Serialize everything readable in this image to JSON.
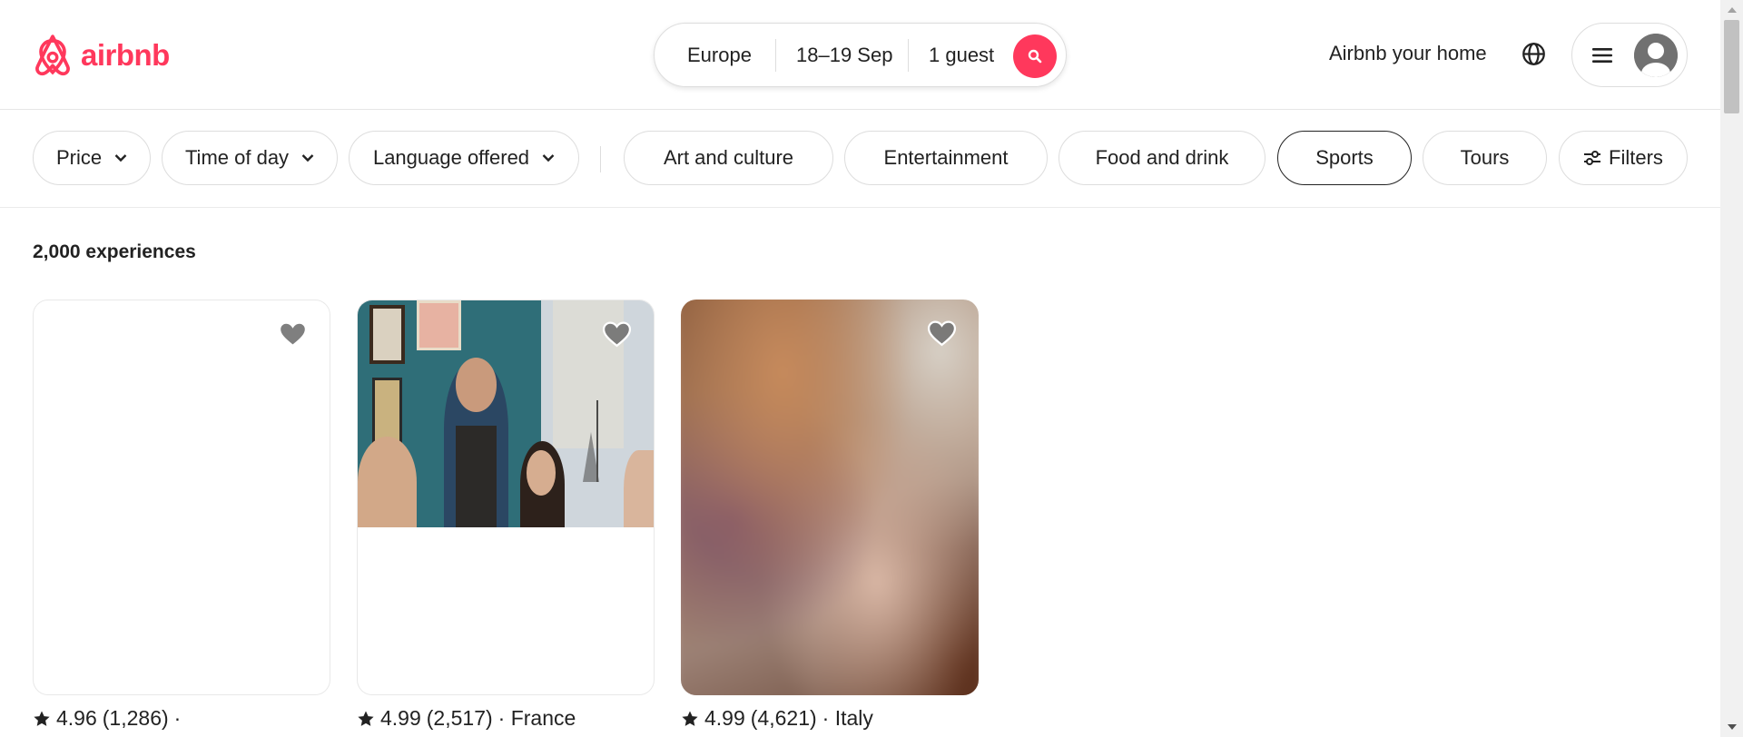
{
  "colors": {
    "brand": "#FF385C",
    "text": "#222222",
    "heart": "#717171"
  },
  "header": {
    "logo_text": "airbnb",
    "search": {
      "where": "Europe",
      "when": "18–19 Sep",
      "who": "1 guest",
      "icon": "search-icon"
    },
    "host_link": "Airbnb your home",
    "globe_icon": "globe-icon",
    "menu_icon": "hamburger-icon",
    "avatar_icon": "user-avatar-icon"
  },
  "filters": {
    "dropdowns": [
      {
        "label": "Price"
      },
      {
        "label": "Time of day"
      },
      {
        "label": "Language offered"
      }
    ],
    "categories": [
      {
        "label": "Art and culture",
        "selected": false
      },
      {
        "label": "Entertainment",
        "selected": false
      },
      {
        "label": "Food and drink",
        "selected": false
      },
      {
        "label": "Sports",
        "selected": true
      },
      {
        "label": "Tours",
        "selected": false
      }
    ],
    "filters_button": "Filters"
  },
  "results": {
    "count": "2,000 experiences",
    "cards": [
      {
        "rating": "4.96",
        "reviews": "(1,286)",
        "location": "·",
        "image": "blank"
      },
      {
        "rating": "4.99",
        "reviews": "(2,517)",
        "location": "· France",
        "image": "wine-tasting-photo"
      },
      {
        "rating": "4.99",
        "reviews": "(4,621)",
        "location": "· Italy",
        "image": "blurred-photo"
      }
    ]
  }
}
